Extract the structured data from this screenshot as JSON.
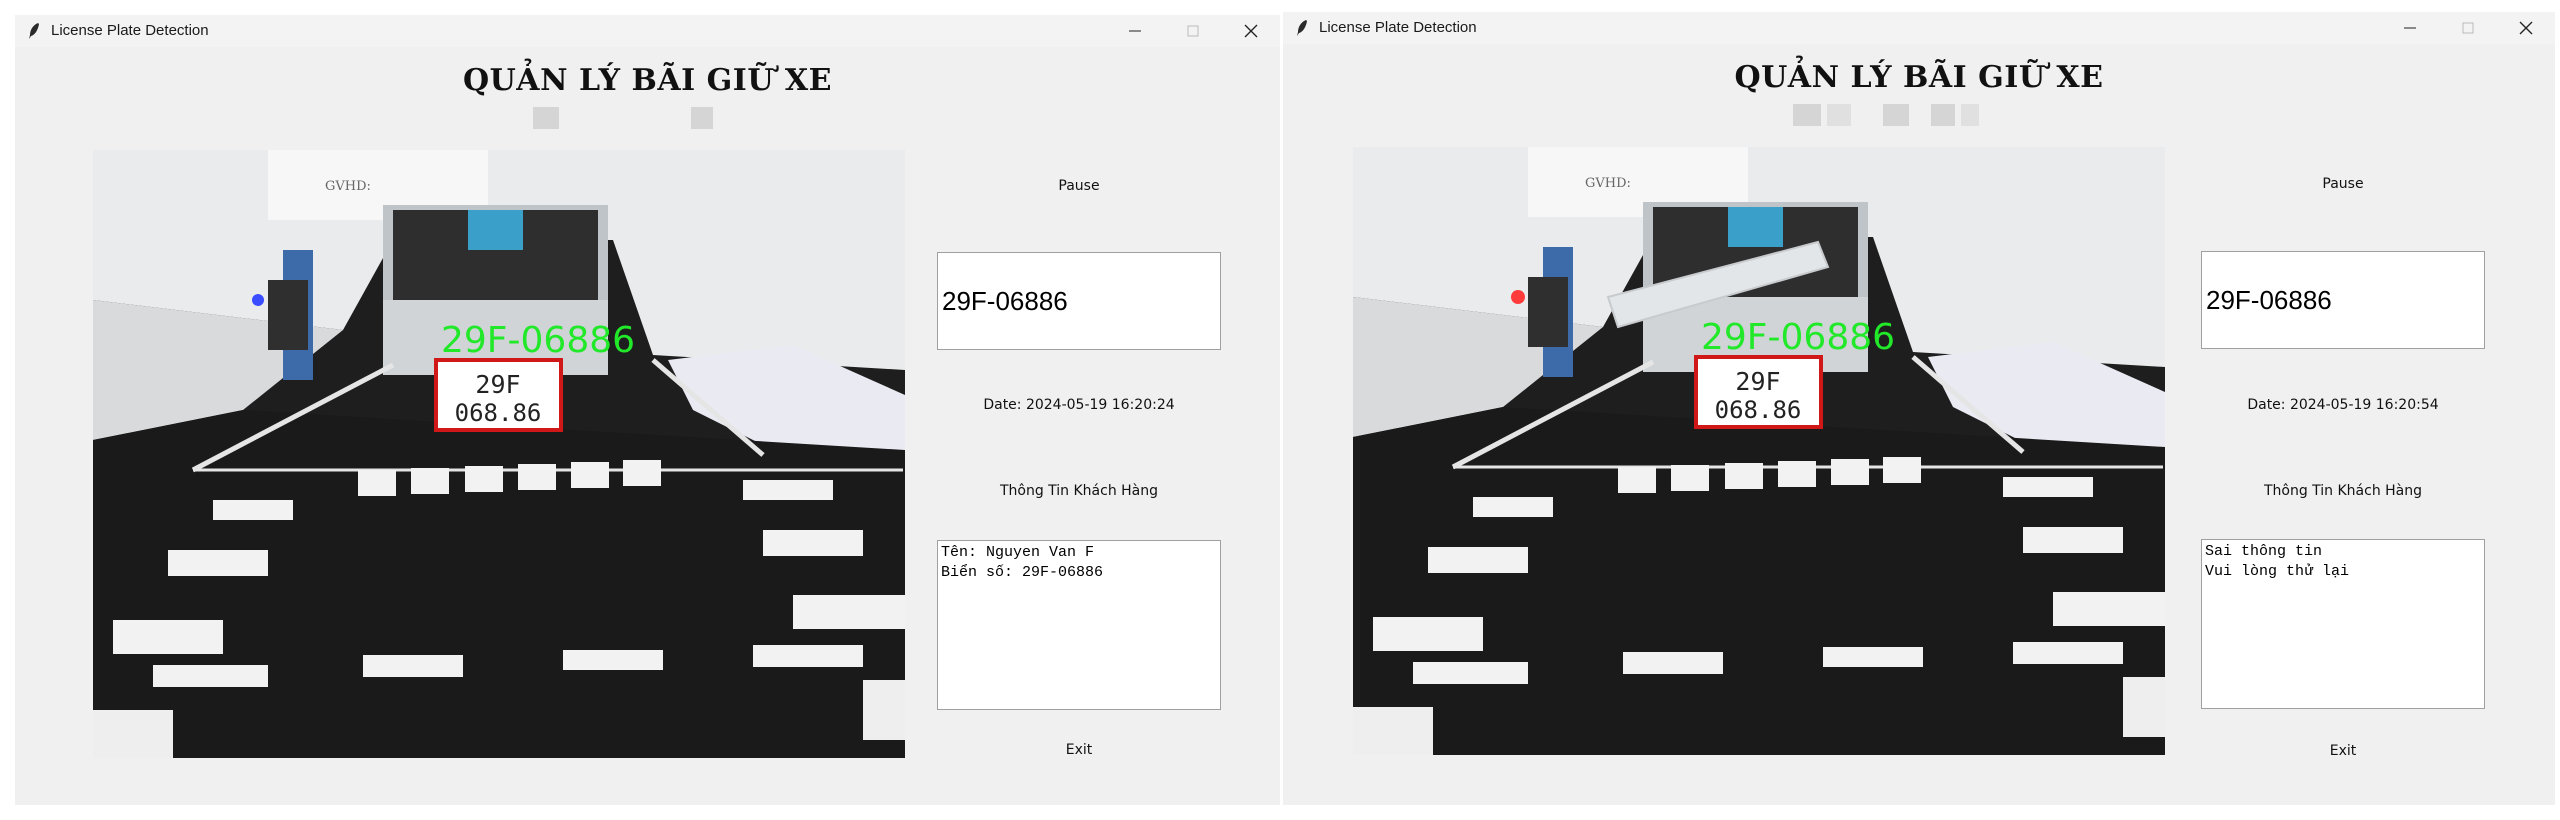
{
  "windows": [
    {
      "title": "License Plate Detection",
      "heading": "QUẢN LÝ BÃI GIỮ XE",
      "pause_label": "Pause",
      "plate_text": "29F-06886",
      "date_text": "Date: 2024-05-19 16:20:24",
      "customer_info_label": "Thông Tin Khách Hàng",
      "customer_info_lines": [
        "Tên: Nguyen Van F",
        "Biển số: 29F-06886"
      ],
      "exit_label": "Exit",
      "overlay_text": "29F-06886",
      "plate_line1": "29F",
      "plate_line2": "068.86",
      "gvhd_label": "GVHD:",
      "indicator_color": "#3a4cff"
    },
    {
      "title": "License Plate Detection",
      "heading": "QUẢN LÝ BÃI GIỮ XE",
      "pause_label": "Pause",
      "plate_text": "29F-06886",
      "date_text": "Date: 2024-05-19 16:20:54",
      "customer_info_label": "Thông Tin Khách Hàng",
      "customer_info_lines": [
        "Sai thông tin",
        "Vui lòng thử lại"
      ],
      "exit_label": "Exit",
      "overlay_text": "29F-06886",
      "plate_line1": "29F",
      "plate_line2": "068.86",
      "gvhd_label": "GVHD:",
      "indicator_color": "#ff3b3b"
    }
  ],
  "colors": {
    "detection_text": "#22e82a",
    "detection_box": "#d01818",
    "window_bg": "#f0f0f0"
  }
}
